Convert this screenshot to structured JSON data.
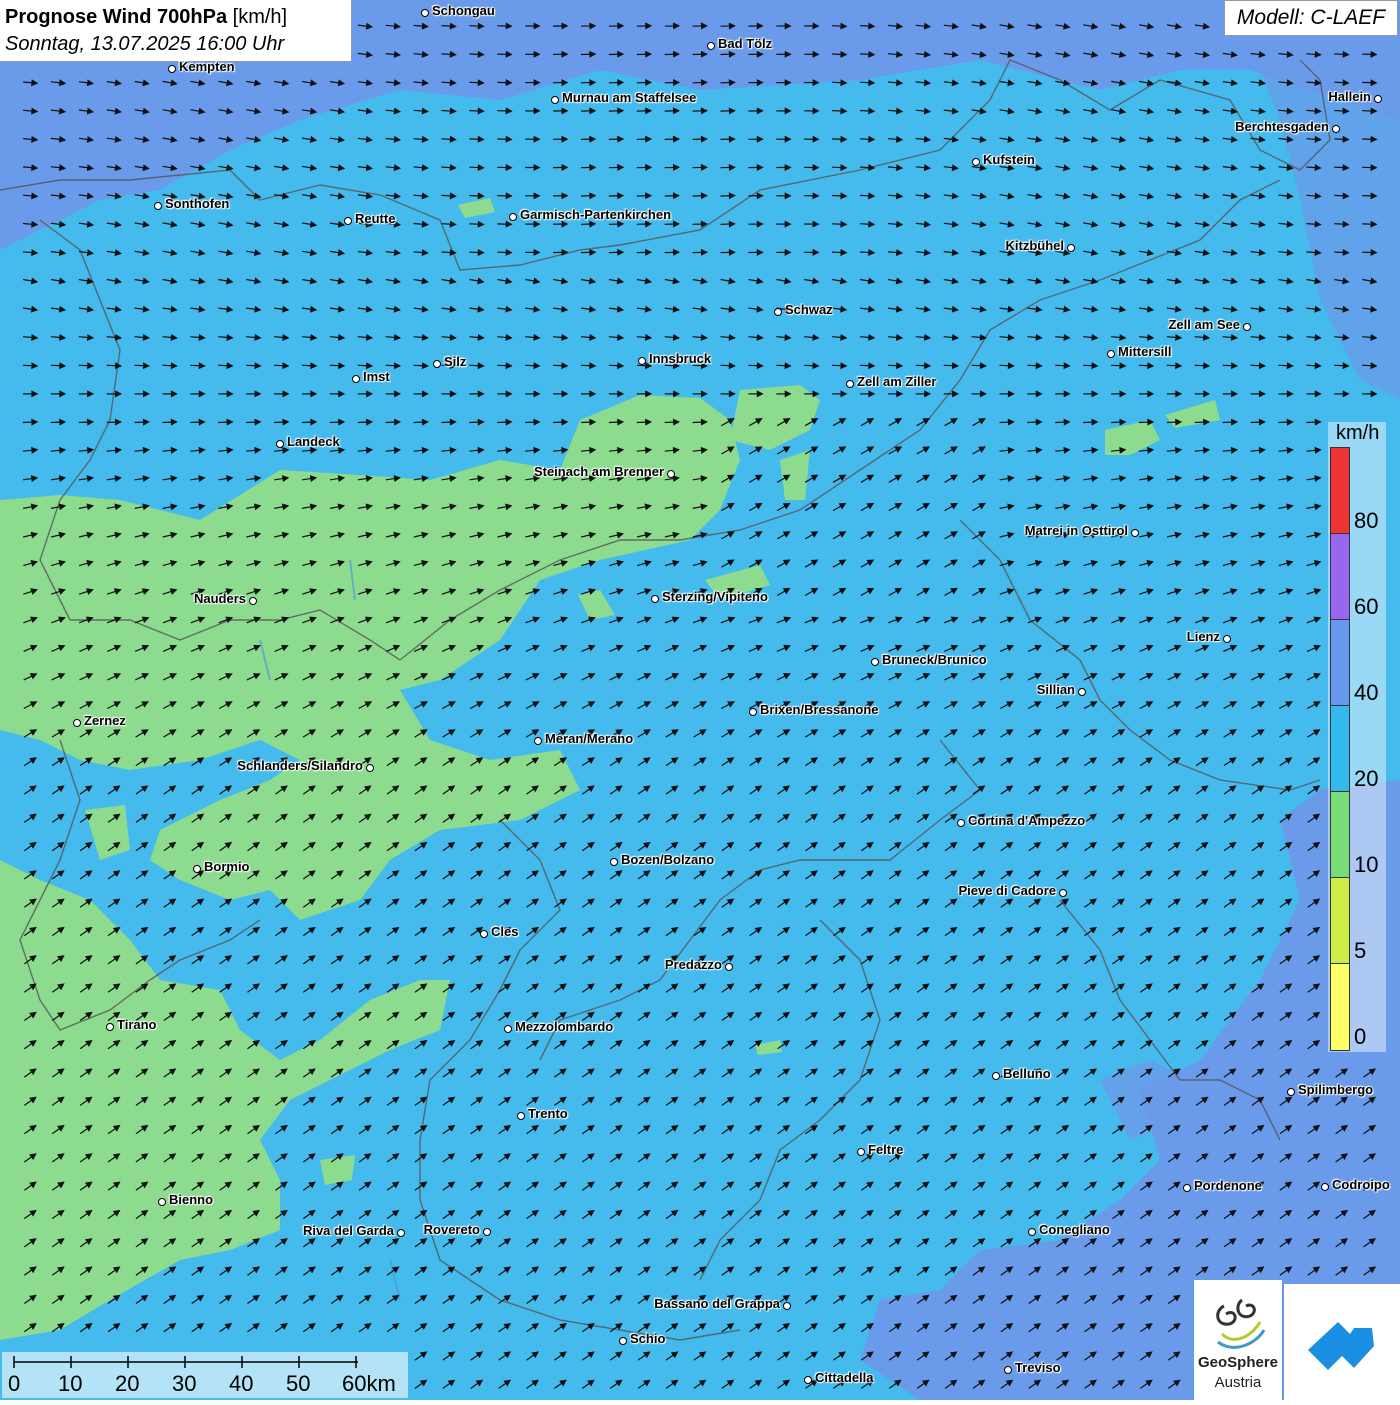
{
  "header": {
    "title": "Prognose Wind 700hPa",
    "unit": "[km/h]",
    "datetime": "Sonntag, 13.07.2025 16:00 Uhr",
    "model": "Modell: C-LAEF"
  },
  "legend": {
    "unit": "km/h",
    "labels": [
      "80",
      "60",
      "40",
      "20",
      "10",
      "5",
      "0"
    ],
    "colors": [
      "#ee3333",
      "#9966ee",
      "#6699ee",
      "#33bbee",
      "#77dd77",
      "#ccee44",
      "#ffff66"
    ]
  },
  "scale_bar": {
    "labels": [
      "0",
      "10",
      "20",
      "30",
      "40",
      "50",
      "60km"
    ]
  },
  "logos": {
    "geosphere_line1": "GeoSphere",
    "geosphere_line2": "Austria"
  },
  "map": {
    "colors": {
      "bg_20_40": "#45baed",
      "zone_10_20": "#8ddb8e",
      "zone_40_60": "#6a9bea",
      "border": "#555555",
      "arrow": "#111111"
    }
  },
  "cities": [
    {
      "name": "Schongau"
    },
    {
      "name": "Bad Tölz"
    },
    {
      "name": "Kempten"
    },
    {
      "name": "Murnau am Staffelsee"
    },
    {
      "name": "Hallein"
    },
    {
      "name": "Berchtesgaden"
    },
    {
      "name": "Kufstein"
    },
    {
      "name": "Sonthofen"
    },
    {
      "name": "Reutte"
    },
    {
      "name": "Garmisch-Partenkirchen"
    },
    {
      "name": "Kitzbühel"
    },
    {
      "name": "Schwaz"
    },
    {
      "name": "Zell am See"
    },
    {
      "name": "Mittersill"
    },
    {
      "name": "Innsbruck"
    },
    {
      "name": "Silz"
    },
    {
      "name": "Imst"
    },
    {
      "name": "Zell am Ziller"
    },
    {
      "name": "Landeck"
    },
    {
      "name": "Steinach am Brenner"
    },
    {
      "name": "Matrei in Osttirol"
    },
    {
      "name": "Nauders"
    },
    {
      "name": "Sterzing/Vipiteno"
    },
    {
      "name": "Lienz"
    },
    {
      "name": "Bruneck/Brunico"
    },
    {
      "name": "Sillian"
    },
    {
      "name": "Zernez"
    },
    {
      "name": "Brixen/Bressanone"
    },
    {
      "name": "Meran/Merano"
    },
    {
      "name": "Schlanders/Silandro"
    },
    {
      "name": "Cortina d'Ampezzo"
    },
    {
      "name": "Bozen/Bolzano"
    },
    {
      "name": "Bormio"
    },
    {
      "name": "Pieve di Cadore"
    },
    {
      "name": "Cles"
    },
    {
      "name": "Predazzo"
    },
    {
      "name": "Tirano"
    },
    {
      "name": "Mezzolombardo"
    },
    {
      "name": "Belluno"
    },
    {
      "name": "Spilimbergo"
    },
    {
      "name": "Trento"
    },
    {
      "name": "Feltre"
    },
    {
      "name": "Pordenone"
    },
    {
      "name": "Codroipo"
    },
    {
      "name": "Bienno"
    },
    {
      "name": "Riva del Garda"
    },
    {
      "name": "Rovereto"
    },
    {
      "name": "Conegliano"
    },
    {
      "name": "Bassano del Grappa"
    },
    {
      "name": "Schio"
    },
    {
      "name": "Treviso"
    },
    {
      "name": "Cittadella"
    }
  ]
}
